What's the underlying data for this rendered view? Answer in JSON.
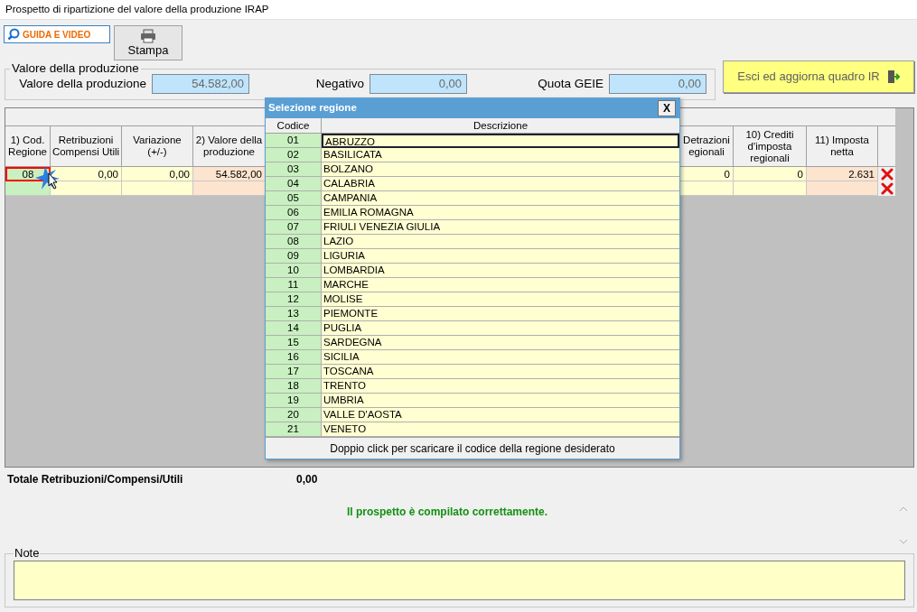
{
  "window": {
    "title": "Prospetto di ripartizione del valore della produzione IRAP"
  },
  "toolbar": {
    "guide_button": "GUIDA E VIDEO",
    "print_button": "Stampa"
  },
  "production": {
    "legend": "Valore della produzione",
    "fields": [
      {
        "label": "Valore della produzione",
        "value": "54.582,00"
      },
      {
        "label": "Negativo",
        "value": "0,00"
      },
      {
        "label": "Quota GEIE",
        "value": "0,00"
      }
    ]
  },
  "exit_button": "Esci ed aggiorna quadro IR",
  "table": {
    "columns": [
      "1) Cod. Regione",
      "Retribuzioni Compensi Utili",
      "Variazione (+/-)",
      "2) Valore della produzione",
      "Detrazioni\negionali",
      "10) Crediti d'imposta regionali",
      "11) Imposta netta"
    ],
    "rows": [
      {
        "cells": [
          "08",
          "0,00",
          "0,00",
          "54.582,00",
          "0",
          "0",
          "2.631"
        ],
        "selected": true
      },
      {
        "selected": false
      }
    ]
  },
  "totals": {
    "label": "Totale Retribuzioni/Compensi/Utili",
    "value": "0,00"
  },
  "message": "Il prospetto è compilato correttamente.",
  "note": {
    "legend": "Note"
  },
  "dialog": {
    "title": "Selezione regione",
    "close": "X",
    "columns": [
      "Codice",
      "Descrizione"
    ],
    "rows": [
      {
        "code": "01",
        "name": "ABRUZZO",
        "selected": true
      },
      {
        "code": "02",
        "name": "BASILICATA",
        "selected": false
      },
      {
        "code": "03",
        "name": "BOLZANO",
        "selected": false
      },
      {
        "code": "04",
        "name": "CALABRIA",
        "selected": false
      },
      {
        "code": "05",
        "name": "CAMPANIA",
        "selected": false
      },
      {
        "code": "06",
        "name": "EMILIA ROMAGNA",
        "selected": false
      },
      {
        "code": "07",
        "name": "FRIULI VENEZIA GIULIA",
        "selected": false
      },
      {
        "code": "08",
        "name": "LAZIO",
        "selected": false
      },
      {
        "code": "09",
        "name": "LIGURIA",
        "selected": false
      },
      {
        "code": "10",
        "name": "LOMBARDIA",
        "selected": false
      },
      {
        "code": "11",
        "name": "MARCHE",
        "selected": false
      },
      {
        "code": "12",
        "name": "MOLISE",
        "selected": false
      },
      {
        "code": "13",
        "name": "PIEMONTE",
        "selected": false
      },
      {
        "code": "14",
        "name": "PUGLIA",
        "selected": false
      },
      {
        "code": "15",
        "name": "SARDEGNA",
        "selected": false
      },
      {
        "code": "16",
        "name": "SICILIA",
        "selected": false
      },
      {
        "code": "17",
        "name": "TOSCANA",
        "selected": false
      },
      {
        "code": "18",
        "name": "TRENTO",
        "selected": false
      },
      {
        "code": "19",
        "name": "UMBRIA",
        "selected": false
      },
      {
        "code": "20",
        "name": "VALLE D'AOSTA",
        "selected": false
      },
      {
        "code": "21",
        "name": "VENETO",
        "selected": false
      }
    ],
    "footer": "Doppio click per scaricare il codice della regione desiderato"
  }
}
